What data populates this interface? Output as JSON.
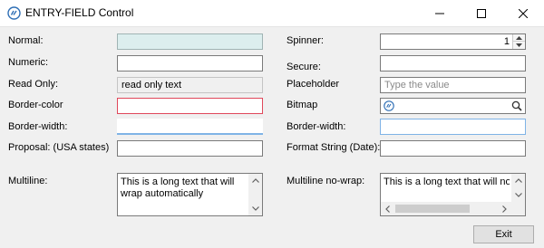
{
  "window": {
    "title": "ENTRY-FIELD Control"
  },
  "left": {
    "normal_label": "Normal:",
    "numeric_label": "Numeric:",
    "readonly_label": "Read Only:",
    "readonly_value": "read only text",
    "border_color_label": "Border-color",
    "border_width_label": "Border-width:",
    "proposal_label": "Proposal: (USA states)",
    "multiline_label": "Multiline:",
    "multiline_text": "This is a long text that will wrap automatically"
  },
  "right": {
    "spinner_label": "Spinner:",
    "spinner_value": "1",
    "secure_label": "Secure:",
    "placeholder_label": "Placeholder",
    "placeholder_text": "Type the value",
    "bitmap_label": "Bitmap",
    "border_width_label": "Border-width:",
    "format_label": "Format String (Date):",
    "multiline_nowrap_label": "Multiline no-wrap:",
    "multiline_nowrap_text": "This is a long text that will not wrap"
  },
  "footer": {
    "exit_label": "Exit"
  },
  "colors": {
    "normal_bg": "#dceeee",
    "border_color_red": "#e0485b",
    "border_width_blue": "#7fb3e6",
    "readonly_bg": "#f0f0f0"
  },
  "icons": {
    "app": "app-logo-icon",
    "minimize": "minimize-icon",
    "maximize": "maximize-icon",
    "close": "close-icon",
    "search": "search-icon"
  }
}
